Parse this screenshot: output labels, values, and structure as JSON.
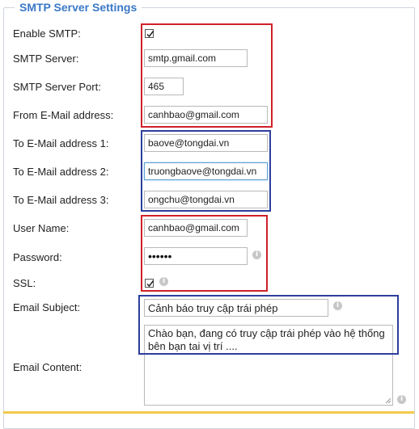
{
  "section": {
    "title": "SMTP Server Settings"
  },
  "fields": {
    "enable_smtp": {
      "label": "Enable SMTP:",
      "checked": true
    },
    "server": {
      "label": "SMTP Server:",
      "value": "smtp.gmail.com"
    },
    "port": {
      "label": "SMTP Server Port:",
      "value": "465"
    },
    "from": {
      "label": "From E-Mail address:",
      "value": "canhbao@gmail.com"
    },
    "to1": {
      "label": "To E-Mail address 1:",
      "value": "baove@tongdai.vn"
    },
    "to2": {
      "label": "To E-Mail address 2:",
      "value": "truongbaove@tongdai.vn"
    },
    "to3": {
      "label": "To E-Mail address 3:",
      "value": "ongchu@tongdai.vn"
    },
    "username": {
      "label": "User Name:",
      "value": "canhbao@gmail.com"
    },
    "password": {
      "label": "Password:",
      "value": "••••••"
    },
    "ssl": {
      "label": "SSL:",
      "checked": true
    },
    "subject": {
      "label": "Email Subject:",
      "value": "Cảnh báo truy cập trái phép"
    },
    "content": {
      "label": "Email Content:",
      "value": "Chào bạn, đang có truy cập trái phép vào hệ thống bên bạn tai vị trí ...."
    }
  },
  "icons": {
    "info": "info-icon",
    "check": "checkmark-icon"
  },
  "colors": {
    "red_box": "#d0202a",
    "blue_box": "#2c3e9e",
    "title": "#3a78c8"
  }
}
